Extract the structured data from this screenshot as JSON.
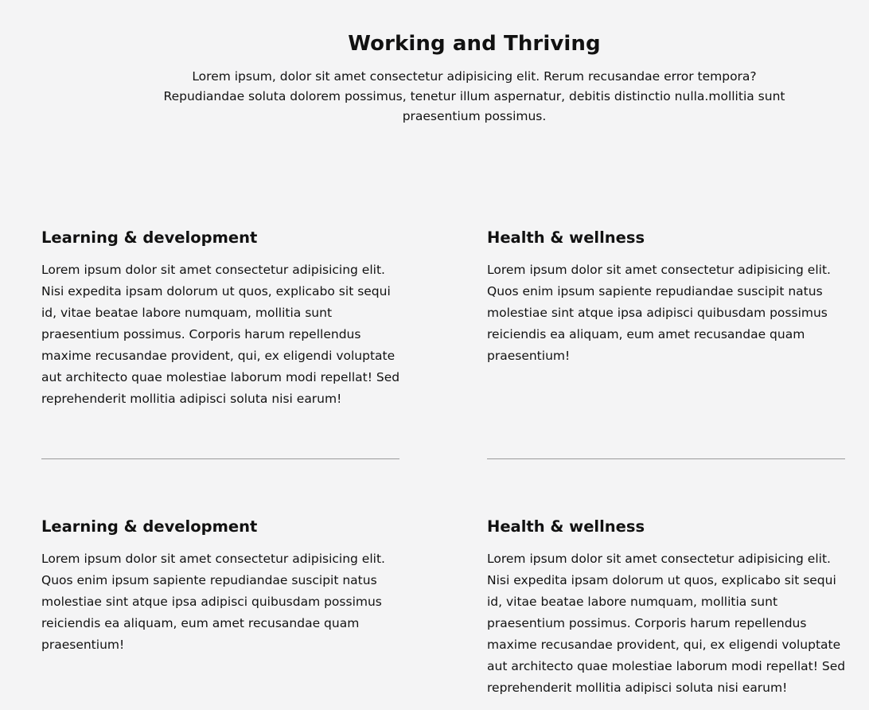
{
  "header": {
    "title": "Working and Thriving",
    "description": "Lorem ipsum, dolor sit amet consectetur adipisicing elit. Rerum recusandae error tempora? Repudiandae soluta dolorem possimus, tenetur illum aspernatur, debitis distinctio nulla.mollitia sunt praesentium possimus."
  },
  "cards": [
    {
      "title": "Learning & development",
      "body": "Lorem ipsum dolor sit amet consectetur adipisicing elit. Nisi expedita ipsam dolorum ut quos, explicabo sit sequi id, vitae beatae labore numquam, mollitia sunt praesentium possimus. Corporis harum repellendus maxime recusandae provident, qui, ex eligendi voluptate aut architecto quae molestiae laborum modi repellat! Sed reprehenderit mollitia adipisci soluta nisi earum!"
    },
    {
      "title": "Health & wellness",
      "body": "Lorem ipsum dolor sit amet consectetur adipisicing elit. Quos enim ipsum sapiente repudiandae suscipit natus molestiae sint atque ipsa adipisci quibusdam possimus reiciendis ea aliquam, eum amet recusandae quam praesentium!"
    },
    {
      "title": "Learning & development",
      "body": "Lorem ipsum dolor sit amet consectetur adipisicing elit. Quos enim ipsum sapiente repudiandae suscipit natus molestiae sint atque ipsa adipisci quibusdam possimus reiciendis ea aliquam, eum amet recusandae quam praesentium!"
    },
    {
      "title": "Health & wellness",
      "body": "Lorem ipsum dolor sit amet consectetur adipisicing elit. Nisi expedita ipsam dolorum ut quos, explicabo sit sequi id, vitae beatae labore numquam, mollitia sunt praesentium possimus. Corporis harum repellendus maxime recusandae provident, qui, ex eligendi voluptate aut architecto quae molestiae laborum modi repellat! Sed reprehenderit mollitia adipisci soluta nisi earum!"
    }
  ]
}
